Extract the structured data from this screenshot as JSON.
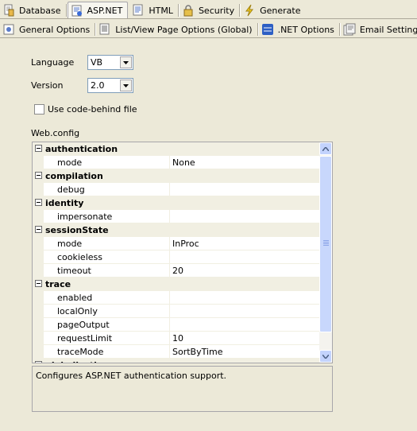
{
  "tabs_row1": [
    {
      "label": "Database",
      "icon": "database-icon",
      "selected": false
    },
    {
      "label": "ASP.NET",
      "icon": "aspnet-page-icon",
      "selected": true
    },
    {
      "label": "HTML",
      "icon": "html-page-icon",
      "selected": false
    },
    {
      "label": "Security",
      "icon": "lock-icon",
      "selected": false
    },
    {
      "label": "Generate",
      "icon": "lightning-icon",
      "selected": false
    }
  ],
  "tabs_row2": [
    {
      "label": "General Options",
      "icon": "general-options-icon",
      "selected": true
    },
    {
      "label": "List/View Page Options (Global)",
      "icon": "list-view-icon",
      "selected": false
    },
    {
      "label": ".NET Options",
      "icon": "aspnet-logo-icon",
      "selected": false
    },
    {
      "label": "Email Settings",
      "icon": "email-icon",
      "selected": false
    }
  ],
  "form": {
    "language_label": "Language",
    "language_value": "VB",
    "version_label": "Version",
    "version_value": "2.0",
    "codebehind_label": "Use code-behind file",
    "codebehind_checked": false,
    "webconfig_label": "Web.config"
  },
  "grid_rows": [
    {
      "type": "category",
      "name": "authentication"
    },
    {
      "type": "prop",
      "name": "mode",
      "value": "None"
    },
    {
      "type": "category",
      "name": "compilation"
    },
    {
      "type": "prop",
      "name": "debug",
      "check": true
    },
    {
      "type": "category",
      "name": "identity"
    },
    {
      "type": "prop",
      "name": "impersonate",
      "check": false
    },
    {
      "type": "category",
      "name": "sessionState"
    },
    {
      "type": "prop",
      "name": "mode",
      "value": "InProc"
    },
    {
      "type": "prop",
      "name": "cookieless",
      "check": false
    },
    {
      "type": "prop",
      "name": "timeout",
      "value": "20"
    },
    {
      "type": "category",
      "name": "trace"
    },
    {
      "type": "prop",
      "name": "enabled",
      "check": false
    },
    {
      "type": "prop",
      "name": "localOnly",
      "check": false
    },
    {
      "type": "prop",
      "name": "pageOutput",
      "check": false
    },
    {
      "type": "prop",
      "name": "requestLimit",
      "value": "10"
    },
    {
      "type": "prop",
      "name": "traceMode",
      "value": "SortByTime"
    },
    {
      "type": "category",
      "name": "globalization"
    }
  ],
  "description": "Configures ASP.NET authentication support.",
  "colors": {
    "window_bg": "#ece9d8",
    "category_bg": "#f1efe2",
    "scrollbar": "#c3d3fd"
  }
}
